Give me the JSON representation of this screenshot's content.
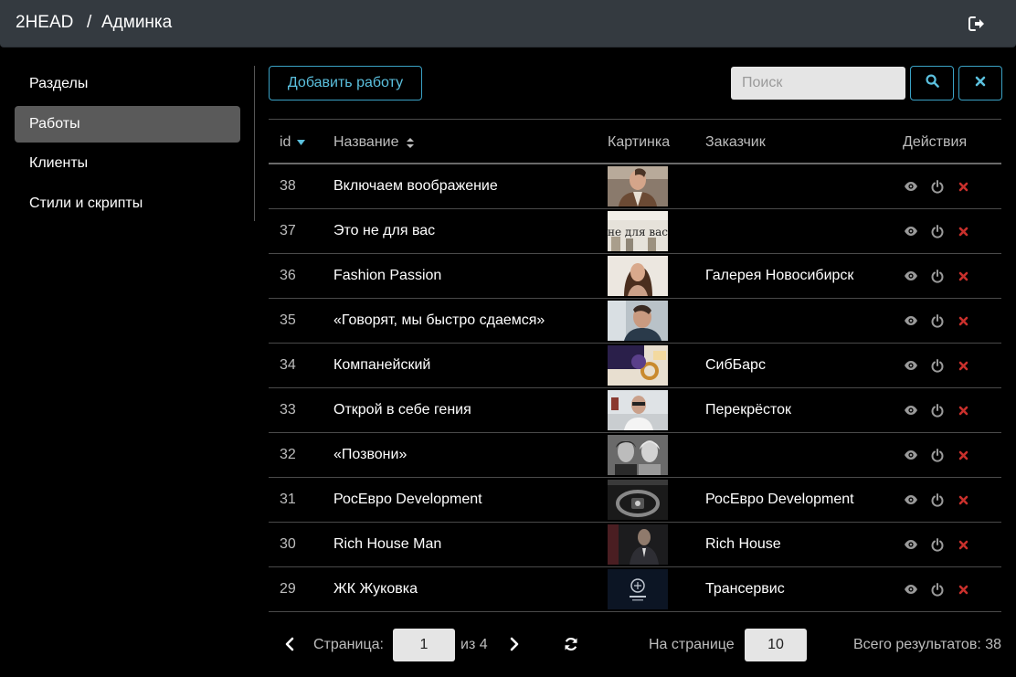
{
  "header": {
    "brand": "2HEAD",
    "separator": "/",
    "section": "Админка",
    "logout_icon": "sign-out-icon"
  },
  "sidebar": {
    "items": [
      {
        "label": "Разделы",
        "active": false
      },
      {
        "label": "Работы",
        "active": true
      },
      {
        "label": "Клиенты",
        "active": false
      },
      {
        "label": "Стили и скрипты",
        "active": false
      }
    ]
  },
  "toolbar": {
    "add_label": "Добавить работу",
    "search_placeholder": "Поиск",
    "search_value": "",
    "accent_color": "#5bc0de"
  },
  "table": {
    "columns": {
      "id": "id",
      "name": "Название",
      "image": "Картинка",
      "client": "Заказчик",
      "actions": "Действия"
    },
    "sort": {
      "column": "id",
      "direction": "desc"
    },
    "rows": [
      {
        "id": "38",
        "name": "Включаем воображение",
        "client": "",
        "thumb": "portrait-man-vest"
      },
      {
        "id": "37",
        "name": "Это не для вас",
        "client": "",
        "thumb": "text-ne-dlya-vas",
        "thumb_text": "не для вас"
      },
      {
        "id": "36",
        "name": "Fashion Passion",
        "client": "Галерея Новосибирск",
        "thumb": "portrait-woman"
      },
      {
        "id": "35",
        "name": "«Говорят, мы быстро сдаемся»",
        "client": "",
        "thumb": "portrait-man-profile"
      },
      {
        "id": "34",
        "name": "Компанейский",
        "client": "СибБарс",
        "thumb": "ring-gold"
      },
      {
        "id": "33",
        "name": "Открой в себе гения",
        "client": "Перекрёсток",
        "thumb": "man-glasses-office"
      },
      {
        "id": "32",
        "name": "«Позвони»",
        "client": "",
        "thumb": "bw-portraits"
      },
      {
        "id": "31",
        "name": "РосЕвро Development",
        "client": "РосЕвро Development",
        "thumb": "steering-wheel"
      },
      {
        "id": "30",
        "name": "Rich House Man",
        "client": "Rich House",
        "thumb": "man-dark-suit"
      },
      {
        "id": "29",
        "name": "ЖК Жуковка",
        "client": "Трансервис",
        "thumb": "dark-logo"
      }
    ],
    "delete_color": "#c9302c"
  },
  "pagination": {
    "page_label": "Страница:",
    "page_value": "1",
    "of_label": "из 4",
    "per_page_label": "На странице",
    "per_page_value": "10",
    "total_label": "Всего результатов: 38"
  }
}
